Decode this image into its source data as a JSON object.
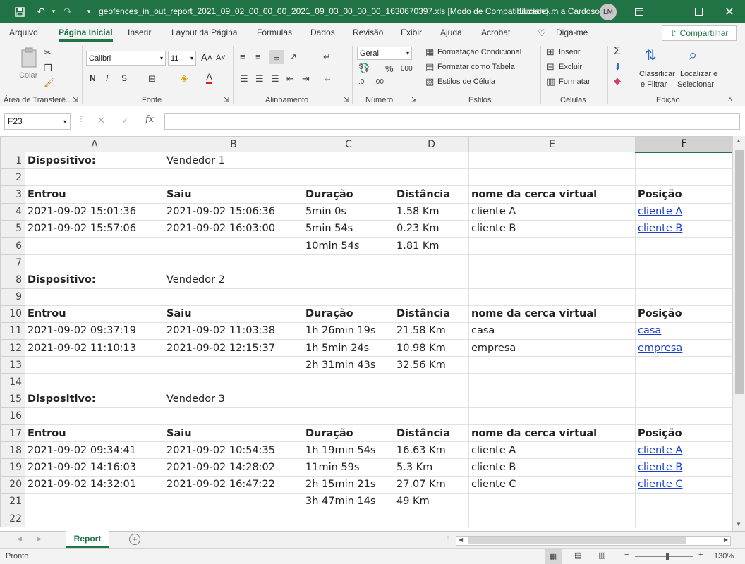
{
  "app": {
    "title": "geofences_in_out_report_2021_09_02_00_00_00_2021_09_03_00_00_00_1630670397.xls  [Modo de Compatibilidade]...",
    "user": "Luciano m a Cardoso",
    "avatar_initials": "LM",
    "accent": "#217346"
  },
  "ribbon_tabs": [
    "Arquivo",
    "Página Inicial",
    "Inserir",
    "Layout da Página",
    "Fórmulas",
    "Dados",
    "Revisão",
    "Exibir",
    "Ajuda",
    "Acrobat",
    "Diga-me"
  ],
  "share_label": "Compartilhar",
  "ribbon": {
    "clipboard": {
      "paste": "Colar",
      "label": "Área de Transferê..."
    },
    "font": {
      "name": "Calibri",
      "size": "11",
      "bold": "N",
      "italic": "I",
      "underline": "S",
      "label": "Fonte"
    },
    "alignment": {
      "label": "Alinhamento"
    },
    "number": {
      "format": "Geral",
      "percent": "%",
      "thousands": "000",
      "label": "Número"
    },
    "styles": {
      "cond": "Formatação Condicional",
      "table": "Formatar como Tabela",
      "cell": "Estilos de Célula",
      "label": "Estilos"
    },
    "cells": {
      "insert": "Inserir",
      "delete": "Excluir",
      "format": "Formatar",
      "label": "Células"
    },
    "editing": {
      "sort": "Classificar",
      "sort2": "e Filtrar",
      "find": "Localizar e",
      "find2": "Selecionar",
      "label": "Edição"
    }
  },
  "formula_bar": {
    "name_box": "F23",
    "formula": ""
  },
  "columns": [
    "A",
    "B",
    "C",
    "D",
    "E",
    "F"
  ],
  "selected_column": "F",
  "rows": [
    {
      "n": "1",
      "cells": [
        "Dispositivo:",
        "Vendedor 1",
        "",
        "",
        "",
        ""
      ],
      "bold": [
        true,
        false
      ]
    },
    {
      "n": "2",
      "cells": [
        "",
        "",
        "",
        "",
        "",
        ""
      ]
    },
    {
      "n": "3",
      "cells": [
        "Entrou",
        "Saiu",
        "Duração",
        "Distância",
        "nome da cerca virtual",
        "Posição"
      ],
      "header": true
    },
    {
      "n": "4",
      "cells": [
        "2021-09-02 15:01:36",
        "2021-09-02 15:06:36",
        "5min 0s",
        "1.58 Km",
        "cliente A",
        "cliente A"
      ],
      "link": true
    },
    {
      "n": "5",
      "cells": [
        "2021-09-02 15:57:06",
        "2021-09-02 16:03:00",
        "5min 54s",
        "0.23 Km",
        "cliente B",
        "cliente B"
      ],
      "link": true
    },
    {
      "n": "6",
      "cells": [
        "",
        "",
        "10min 54s",
        "1.81 Km",
        "",
        ""
      ]
    },
    {
      "n": "7",
      "cells": [
        "",
        "",
        "",
        "",
        "",
        ""
      ]
    },
    {
      "n": "8",
      "cells": [
        "Dispositivo:",
        "Vendedor 2",
        "",
        "",
        "",
        ""
      ],
      "bold": [
        true,
        false
      ]
    },
    {
      "n": "9",
      "cells": [
        "",
        "",
        "",
        "",
        "",
        ""
      ]
    },
    {
      "n": "10",
      "cells": [
        "Entrou",
        "Saiu",
        "Duração",
        "Distância",
        "nome da cerca virtual",
        "Posição"
      ],
      "header": true
    },
    {
      "n": "11",
      "cells": [
        "2021-09-02 09:37:19",
        "2021-09-02 11:03:38",
        "1h 26min 19s",
        "21.58 Km",
        "casa",
        "casa"
      ],
      "link": true
    },
    {
      "n": "12",
      "cells": [
        "2021-09-02 11:10:13",
        "2021-09-02 12:15:37",
        "1h 5min 24s",
        "10.98 Km",
        "empresa",
        "empresa"
      ],
      "link": true
    },
    {
      "n": "13",
      "cells": [
        "",
        "",
        "2h 31min 43s",
        "32.56 Km",
        "",
        ""
      ]
    },
    {
      "n": "14",
      "cells": [
        "",
        "",
        "",
        "",
        "",
        ""
      ]
    },
    {
      "n": "15",
      "cells": [
        "Dispositivo:",
        "Vendedor 3",
        "",
        "",
        "",
        ""
      ],
      "bold": [
        true,
        false
      ]
    },
    {
      "n": "16",
      "cells": [
        "",
        "",
        "",
        "",
        "",
        ""
      ]
    },
    {
      "n": "17",
      "cells": [
        "Entrou",
        "Saiu",
        "Duração",
        "Distância",
        "nome da cerca virtual",
        "Posição"
      ],
      "header": true
    },
    {
      "n": "18",
      "cells": [
        "2021-09-02 09:34:41",
        "2021-09-02 10:54:35",
        "1h 19min 54s",
        "16.63 Km",
        "cliente A",
        "cliente A"
      ],
      "link": true
    },
    {
      "n": "19",
      "cells": [
        "2021-09-02 14:16:03",
        "2021-09-02 14:28:02",
        "11min 59s",
        "5.3 Km",
        "cliente B",
        "cliente B"
      ],
      "link": true
    },
    {
      "n": "20",
      "cells": [
        "2021-09-02 14:32:01",
        "2021-09-02 16:47:22",
        "2h 15min 21s",
        "27.07 Km",
        "cliente C",
        "cliente C"
      ],
      "link": true
    },
    {
      "n": "21",
      "cells": [
        "",
        "",
        "3h 47min 14s",
        "49 Km",
        "",
        ""
      ]
    },
    {
      "n": "22",
      "cells": [
        "",
        "",
        "",
        "",
        "",
        ""
      ]
    }
  ],
  "sheet_tab": "Report",
  "status": {
    "ready": "Pronto",
    "zoom": "130%"
  }
}
